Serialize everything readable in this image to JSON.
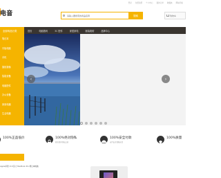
{
  "top_links": [
    "登录",
    "免费注册",
    "个人中心",
    "我的订单",
    "收藏夹",
    "网站导航"
  ],
  "logo": {
    "text": "电音"
  },
  "search": {
    "placeholder": "请输入要搜索的商品名称",
    "button_label": "搜索"
  },
  "cart": {
    "label": "购物车"
  },
  "nav": {
    "category_label": "全部商品分类",
    "items": [
      "首页",
      "电脑数码",
      "3C 配件",
      "家居家电",
      "服装鞋帽",
      "品牌中心"
    ]
  },
  "sidebar": {
    "items": [
      "笔记本",
      "平板电脑",
      "手机",
      "摄影摄像",
      "智能设备",
      "电脑配件",
      "办公设备",
      "家用电器",
      "生活电器"
    ]
  },
  "carousel": {
    "prev_label": "‹",
    "next_label": "›",
    "dot_count": 6,
    "active_dot": 0
  },
  "guarantees": [
    {
      "title": "100%正品低价",
      "subtitle": "",
      "icon": "shield-check-icon"
    },
    {
      "title": "100%绝对隐私",
      "subtitle": "匿名保护隐私交易",
      "icon": "lock-icon"
    },
    {
      "title": "100%安全付款",
      "subtitle": "支付安全保障无忧",
      "icon": "umbrella-icon"
    },
    {
      "title": "100%质量",
      "subtitle": "",
      "icon": "diamond-icon"
    }
  ],
  "product": {
    "text": "Apple苹果 13.3英寸 MacBook Pro 笔记本电脑"
  },
  "colors": {
    "accent": "#f5b400",
    "nav_bg": "#3a3530"
  }
}
